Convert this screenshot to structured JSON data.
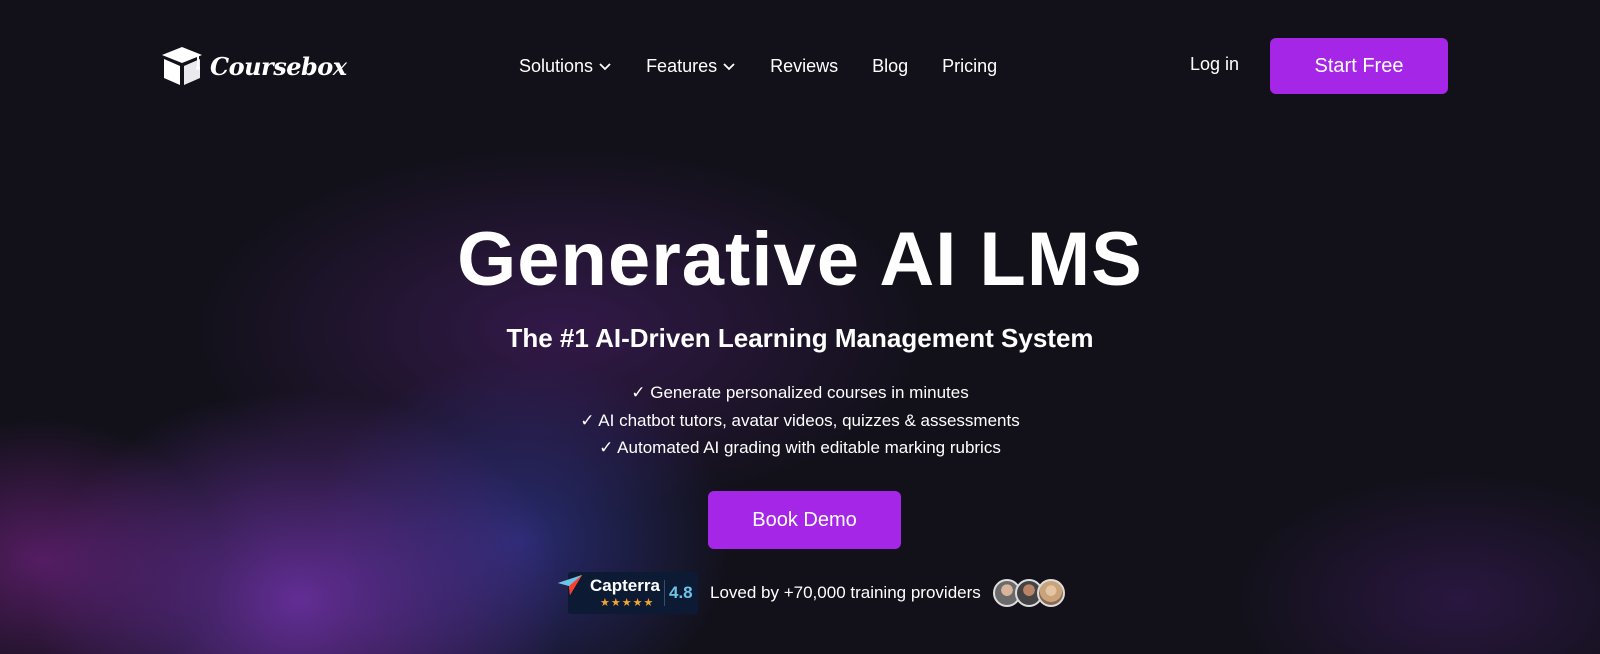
{
  "nav": {
    "logo_text": "Coursebox",
    "links": [
      {
        "label": "Solutions",
        "has_dropdown": true
      },
      {
        "label": "Features",
        "has_dropdown": true
      },
      {
        "label": "Reviews",
        "has_dropdown": false
      },
      {
        "label": "Blog",
        "has_dropdown": false
      },
      {
        "label": "Pricing",
        "has_dropdown": false
      }
    ],
    "login_label": "Log in",
    "cta_label": "Start Free"
  },
  "hero": {
    "title": "Generative AI LMS",
    "subtitle": "The #1 AI-Driven Learning Management System",
    "bullets": [
      "✓ Generate personalized courses in minutes",
      "✓ AI chatbot tutors, avatar videos, quizzes & assessments",
      "✓ Automated AI grading with editable marking rubrics"
    ],
    "demo_label": "Book Demo"
  },
  "social_proof": {
    "capterra_name": "Capterra",
    "capterra_stars": "★★★★★",
    "capterra_score": "4.8",
    "loved_text": "Loved by +70,000 training providers"
  },
  "colors": {
    "accent": "#a626e8",
    "background": "#12111a",
    "capterra_bg": "#0c1a33",
    "star": "#f3a531",
    "score": "#6ec3e8"
  },
  "icons": {
    "logo": "graduation-box-icon",
    "dropdown": "chevron-down-icon",
    "capterra": "capterra-arrow-icon"
  }
}
